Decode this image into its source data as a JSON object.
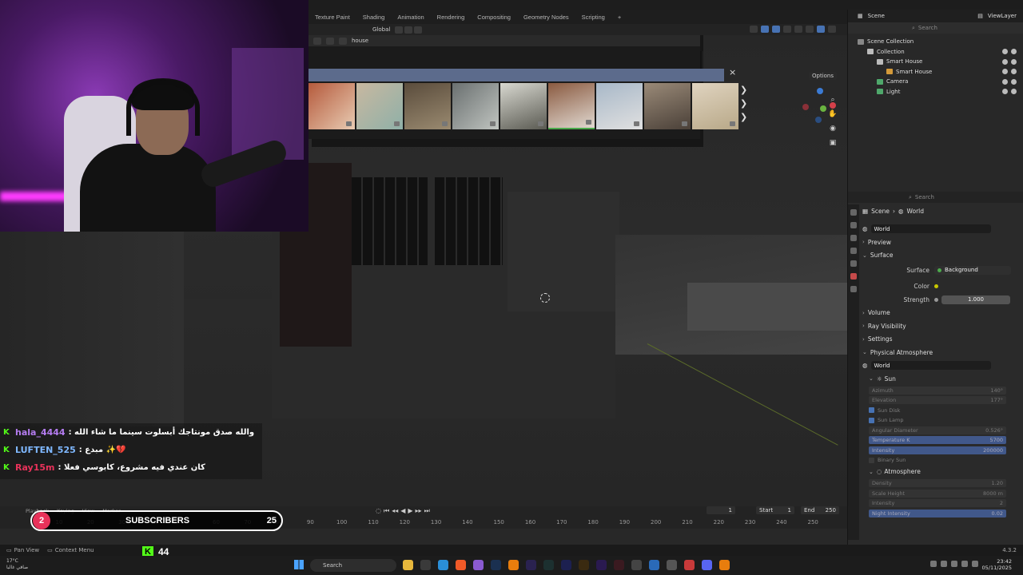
{
  "workspace_tabs": [
    "Texture Paint",
    "Shading",
    "Animation",
    "Rendering",
    "Compositing",
    "Geometry Nodes",
    "Scripting",
    "+"
  ],
  "view_toolbar": {
    "orientation": "Global"
  },
  "asset_browser": {
    "search_value": "house",
    "close": "×",
    "arrows": [
      "❯",
      "❯",
      "❯"
    ]
  },
  "viewport": {
    "options_label": "Options"
  },
  "chat": [
    {
      "user": "hala_4444",
      "user_color": "#b47cf0",
      "message": ": والله صدق مونتاجك أبسلوت سينما ما شاء الله"
    },
    {
      "user": "LUFTEN_525",
      "user_color": "#7fb8ff",
      "message": ": مبدع ✨💔"
    },
    {
      "user": "Ray15m",
      "user_color": "#e8325a",
      "message": ": كان عندي فيه مشروع، كابوسي فعلا"
    }
  ],
  "timeline": {
    "header": [
      "Playback",
      "Keying",
      "View",
      "Marker"
    ],
    "current_frame": "1",
    "start_label": "Start",
    "start_value": "1",
    "end_label": "End",
    "end_value": "250",
    "ticks": [
      "10",
      "20",
      "30",
      "40",
      "50",
      "60",
      "70",
      "80",
      "90",
      "100",
      "110",
      "120",
      "130",
      "140",
      "150",
      "160",
      "170",
      "180",
      "190",
      "200",
      "210",
      "220",
      "230",
      "240",
      "250"
    ]
  },
  "subscribers": {
    "badge": "2",
    "label": "SUBSCRIBERS",
    "count": "25"
  },
  "kick": {
    "logo": "K",
    "count": "44"
  },
  "status_bar": {
    "left": "Pan View",
    "middle": "Context Menu",
    "version": "4.3.2"
  },
  "outliner": {
    "scene": "Scene",
    "view_layer": "ViewLayer",
    "search_placeholder": "Search",
    "rows": [
      {
        "label": "Scene Collection",
        "indent": 0,
        "color": "#888"
      },
      {
        "label": "Collection",
        "indent": 1,
        "color": "#bbb"
      },
      {
        "label": "Smart House",
        "indent": 2,
        "color": "#bbb"
      },
      {
        "label": "Smart House",
        "indent": 3,
        "color": "#d49a3a"
      },
      {
        "label": "Camera",
        "indent": 2,
        "color": "#4fa86b"
      },
      {
        "label": "Light",
        "indent": 2,
        "color": "#4fa86b"
      }
    ]
  },
  "properties": {
    "search_placeholder": "Search",
    "breadcrumb_scene": "Scene",
    "breadcrumb_world": "World",
    "world_name": "World",
    "preview": "Preview",
    "surface": "Surface",
    "surface_label": "Surface",
    "surface_value": "Background",
    "color_label": "Color",
    "strength_label": "Strength",
    "strength_value": "1.000",
    "volume": "Volume",
    "ray_visibility": "Ray Visibility",
    "settings": "Settings",
    "physical_atmosphere": "Physical Atmosphere",
    "pa_world": "World",
    "sun": "Sun",
    "azimuth": "Azimuth",
    "azimuth_value": "140°",
    "elevation": "Elevation",
    "elevation_value": "177°",
    "sun_disk": "Sun Disk",
    "sun_lamp": "Sun Lamp",
    "angular_diameter": "Angular Diameter",
    "angular_diameter_value": "0.526°",
    "temperature": "Temperature K",
    "temperature_value": "5700",
    "intensity": "Intensity",
    "intensity_value": "200000",
    "binary_sun": "Binary Sun",
    "atmosphere": "Atmosphere",
    "density": "Density",
    "density_value": "1.20",
    "scale_height": "Scale Height",
    "scale_height_value": "8000 m",
    "atm_intensity": "Intensity",
    "atm_intensity_value": "2",
    "night_intensity": "Night Intensity",
    "night_intensity_value": "0.02"
  },
  "taskbar": {
    "weather_temp": "17°C",
    "weather_text": "صافي غالبا",
    "search_label": "Search",
    "time": "23:42",
    "date": "05/11/2025"
  }
}
